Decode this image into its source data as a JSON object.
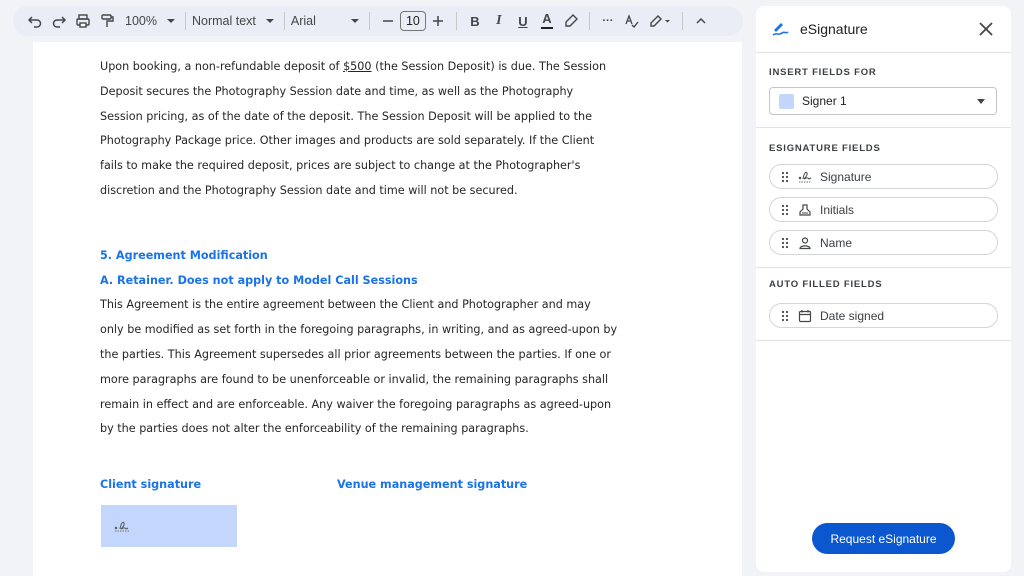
{
  "toolbar": {
    "zoom": "100%",
    "style": "Normal text",
    "font": "Arial",
    "font_size": "10",
    "bold": "B",
    "italic": "I",
    "underline": "U",
    "text_color": "A",
    "more": "···"
  },
  "document": {
    "para1": {
      "line1_pre": "Upon booking, a non-refundable deposit of ",
      "line1_amount": "$500",
      "line1_post": " (the Session Deposit) is due. The Session",
      "lines": [
        "Deposit secures the Photography Session date and time, as well as the Photography",
        "Session pricing, as of the date of the deposit. The Session Deposit will be applied to the",
        "Photography Package price. Other images and products are sold separately. If the Client",
        "fails to make the required deposit, prices are subject to change at the Photographer's",
        "discretion and the Photography Session date and time will not be secured."
      ]
    },
    "heading1": "5. Agreement Modification",
    "heading2": "A. Retainer.  Does not apply to Model Call Sessions",
    "para2": [
      "This Agreement is the entire agreement between the Client and Photographer and may",
      "only be modified as set forth in the foregoing paragraphs, in writing, and as agreed-upon by",
      "the parties.  This Agreement supersedes all prior agreements between the parties. If one or",
      "more paragraphs are found to be unenforceable or invalid, the remaining paragraphs shall",
      "remain in effect and are enforceable. Any waiver the foregoing paragraphs as agreed-upon",
      "by the parties does not alter the enforceability of the remaining paragraphs."
    ],
    "client_signature_label": "Client signature",
    "venue_signature_label": "Venue management signature"
  },
  "panel": {
    "title": "eSignature",
    "insert_fields_label": "INSERT FIELDS FOR",
    "signer": "Signer 1",
    "esignature_fields_label": "ESIGNATURE FIELDS",
    "fields": [
      {
        "label": "Signature",
        "icon": "signature-icon"
      },
      {
        "label": "Initials",
        "icon": "initials-icon"
      },
      {
        "label": "Name",
        "icon": "person-icon"
      }
    ],
    "auto_filled_label": "AUTO FILLED FIELDS",
    "auto_fields": [
      {
        "label": "Date signed",
        "icon": "calendar-icon"
      }
    ],
    "request_button": "Request eSignature"
  },
  "colors": {
    "accent": "#0b57d0",
    "heading_blue": "#1a73e8",
    "signer_swatch": "#c2d7fb",
    "toolbar_bg": "#e9eef6"
  }
}
